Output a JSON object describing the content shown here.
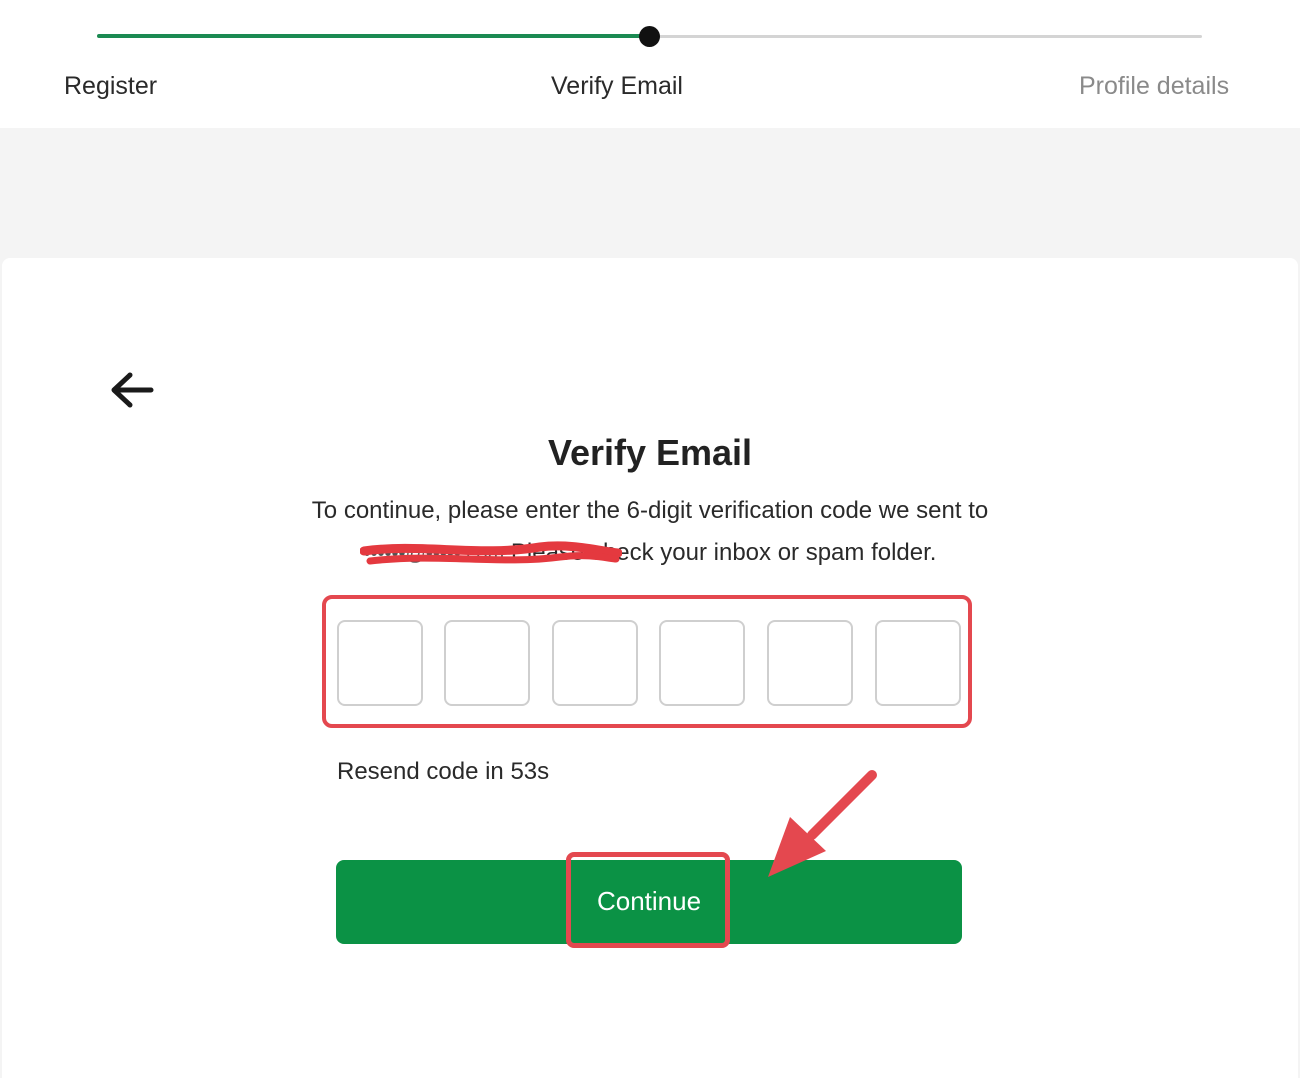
{
  "stepper": {
    "steps": [
      {
        "label": "Register",
        "state": "done"
      },
      {
        "label": "Verify Email",
        "state": "current"
      },
      {
        "label": "Profile details",
        "state": "upcoming"
      }
    ],
    "active_color": "#1b8a52"
  },
  "page": {
    "back_icon": "arrow-left-icon",
    "title": "Verify Email",
    "description_line1": "To continue, please enter the 6-digit verification code we sent to",
    "email_redacted": "••••••@•••••.com",
    "description_line2": " Please check your inbox or spam folder.",
    "code_digits": [
      "",
      "",
      "",
      "",
      "",
      ""
    ],
    "resend_text": "Resend code in 53s",
    "continue_label": "Continue"
  },
  "colors": {
    "primary_button": "#0b9245",
    "annotation": "#e4484f"
  }
}
